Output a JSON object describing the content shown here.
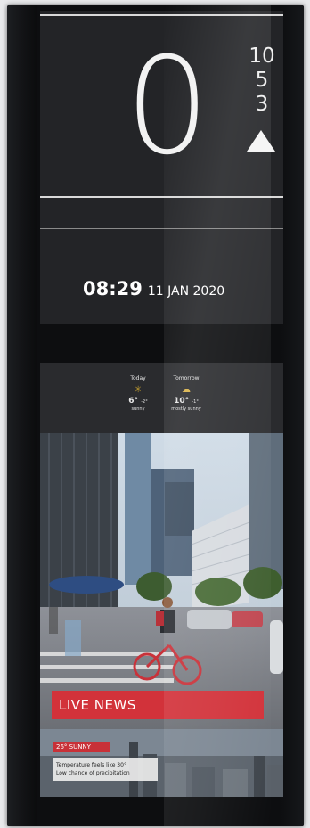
{
  "elevator": {
    "current_floor": "0",
    "floors": [
      "10",
      "5",
      "3"
    ],
    "direction_icon": "triangle-up-icon"
  },
  "clock": {
    "time": "08:29",
    "date": "11 JAN 2020"
  },
  "weather": {
    "today": {
      "label": "Today",
      "icon": "sun-icon",
      "high": "6°",
      "low": "-2°",
      "condition": "sunny"
    },
    "tomorrow": {
      "label": "Tomorrow",
      "icon": "partly-cloudy-icon",
      "high": "10°",
      "low": "-1°",
      "condition": "mostly sunny"
    }
  },
  "news": {
    "label": "LIVE NEWS"
  },
  "forecast_card": {
    "badge": "26° SUNNY",
    "line1": "Temperature feels like 30°",
    "line2": "Low chance of precipitation"
  },
  "colors": {
    "accent_red": "#d2323a",
    "panel": "#232427",
    "frame": "#0d0e10"
  }
}
